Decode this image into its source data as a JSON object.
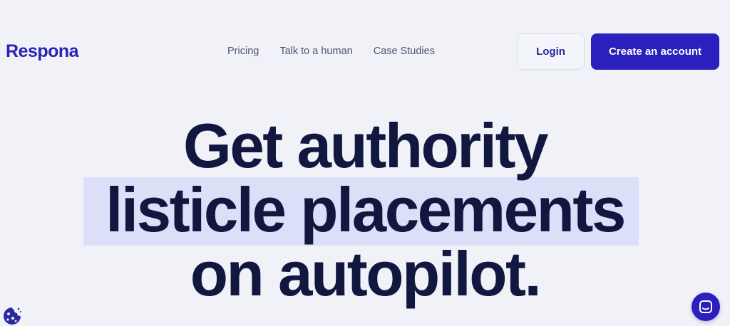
{
  "header": {
    "logo_text": "Respona",
    "nav": [
      {
        "label": "Pricing"
      },
      {
        "label": "Talk to a human"
      },
      {
        "label": "Case Studies"
      }
    ],
    "login_label": "Login",
    "create_account_label": "Create an account"
  },
  "hero": {
    "line1": "Get authority",
    "line2": "listicle placements",
    "line3": "on autopilot."
  },
  "icons": {
    "cookie": "cookie-icon",
    "chat": "chat-icon"
  },
  "colors": {
    "background": "#f1f2f8",
    "brand": "#2b1fbe",
    "heading": "#11173f",
    "highlight": "#dcdff8"
  }
}
